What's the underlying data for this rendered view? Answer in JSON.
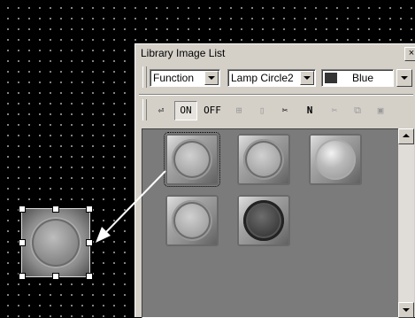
{
  "window": {
    "title": "Library Image List",
    "close_glyph": "×"
  },
  "toolbar": {
    "category_value": "Function",
    "shape_value": "Lamp Circle2",
    "color_value": "Blue",
    "color_swatch": "#333333"
  },
  "tools": [
    {
      "name": "back-icon",
      "glyph": "⏎"
    },
    {
      "name": "on-button",
      "glyph": "ON"
    },
    {
      "name": "off-button",
      "glyph": "OFF"
    },
    {
      "name": "new-folder-icon",
      "glyph": "⊞"
    },
    {
      "name": "new-file-icon",
      "glyph": "▯"
    },
    {
      "name": "tools-icon",
      "glyph": "✂"
    },
    {
      "name": "n-icon",
      "glyph": "N"
    },
    {
      "name": "cut-icon",
      "glyph": "✂"
    },
    {
      "name": "copy-icon",
      "glyph": "⧉"
    },
    {
      "name": "paste-icon",
      "glyph": "▣"
    }
  ],
  "lamps": [
    {
      "name": "lamp-ring-grey",
      "state": "selected"
    },
    {
      "name": "lamp-cross-grey",
      "state": "normal"
    },
    {
      "name": "lamp-bright",
      "state": "on"
    },
    {
      "name": "lamp-plain",
      "state": "normal"
    },
    {
      "name": "lamp-dark-ring",
      "state": "dark"
    }
  ],
  "colors": {
    "canvas": "#000000",
    "window_bg": "#d4d0c8",
    "list_bg": "#7b7b7b",
    "arrow": "#ffffff"
  }
}
